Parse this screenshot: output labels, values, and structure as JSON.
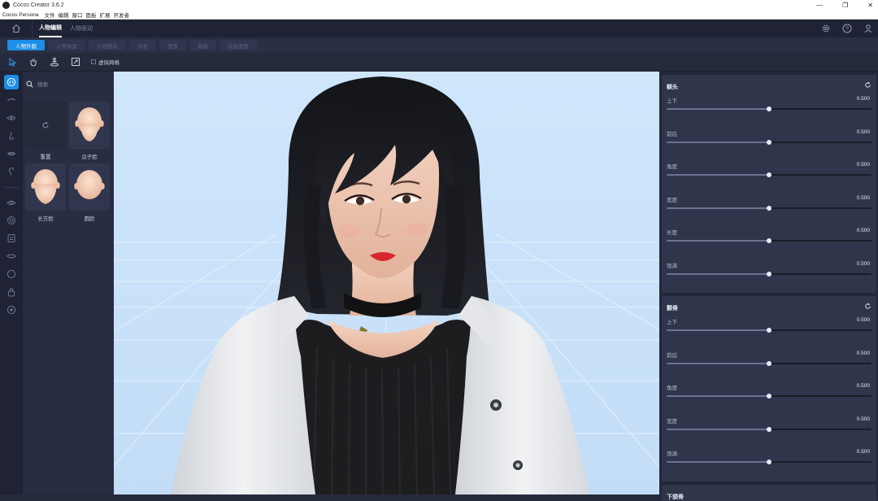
{
  "window": {
    "title": "Cocos Creator 3.6.2",
    "controls": [
      "—",
      "❐",
      "✕"
    ]
  },
  "menubar": {
    "app": "Cocos Persona",
    "items": [
      "文件",
      "编辑",
      "窗口",
      "面板",
      "扩展",
      "开发者"
    ]
  },
  "topnav": {
    "tabs": [
      "人物编辑",
      "人物驱动"
    ],
    "active": 0
  },
  "subtabs": {
    "items": [
      "人物外貌",
      "人物体型",
      "人物服装",
      "头发",
      "面妆",
      "唇釉",
      "动画面管"
    ],
    "active": 0
  },
  "toolbar": {
    "grid_label": "虚拟网格"
  },
  "library": {
    "search_placeholder": "搜索",
    "items": [
      {
        "label": "重置",
        "kind": "reset"
      },
      {
        "label": "瓜子脸",
        "kind": "face"
      },
      {
        "label": "长方脸",
        "kind": "face"
      },
      {
        "label": "圆脸",
        "kind": "face"
      }
    ]
  },
  "panel": {
    "sections": [
      {
        "title": "额头",
        "rows": [
          {
            "label": "上下",
            "value": "0.500",
            "level": 0.5
          },
          {
            "label": "前后",
            "value": "0.500",
            "level": 0.5
          },
          {
            "label": "角度",
            "value": "0.500",
            "level": 0.5
          },
          {
            "label": "宽度",
            "value": "0.500",
            "level": 0.5
          },
          {
            "label": "长度",
            "value": "0.500",
            "level": 0.5
          },
          {
            "label": "饱满",
            "value": "0.500",
            "level": 0.5
          }
        ]
      },
      {
        "title": "颧骨",
        "rows": [
          {
            "label": "上下",
            "value": "0.500",
            "level": 0.5
          },
          {
            "label": "前后",
            "value": "0.500",
            "level": 0.5
          },
          {
            "label": "角度",
            "value": "0.500",
            "level": 0.5
          },
          {
            "label": "宽度",
            "value": "0.500",
            "level": 0.5
          },
          {
            "label": "饱满",
            "value": "0.500",
            "level": 0.5
          }
        ]
      },
      {
        "title": "下颌骨",
        "rows": []
      }
    ]
  },
  "colors": {
    "accent": "#1d8ee8",
    "viewport_sky": "#cfe6fb"
  }
}
